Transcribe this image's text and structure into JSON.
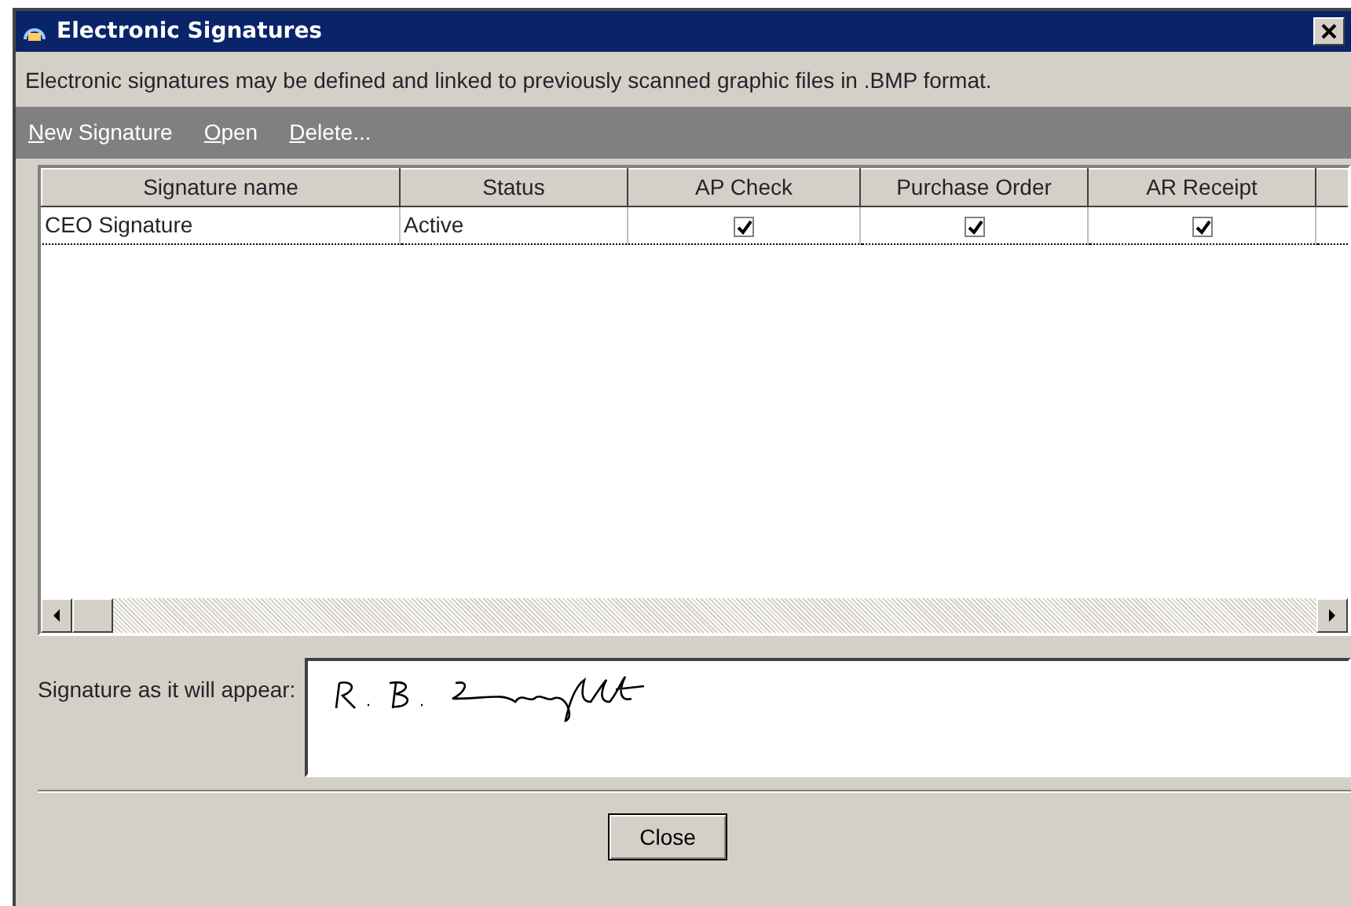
{
  "window": {
    "title": "Electronic Signatures"
  },
  "description": "Electronic signatures may be defined and linked to previously scanned graphic files in .BMP format.",
  "toolbar": [
    "New Signature",
    "Open",
    "Delete..."
  ],
  "table": {
    "columns": [
      "Signature name",
      "Status",
      "AP Check",
      "Purchase Order",
      "AR Receipt"
    ],
    "rows": [
      {
        "selected": true,
        "name": "CEO Signature",
        "status": "Active",
        "ap_check": true,
        "purchase_order": true,
        "ar_receipt": true
      }
    ]
  },
  "signature_preview": {
    "label": "Signature as it will appear:"
  },
  "buttons": [
    "Close"
  ]
}
